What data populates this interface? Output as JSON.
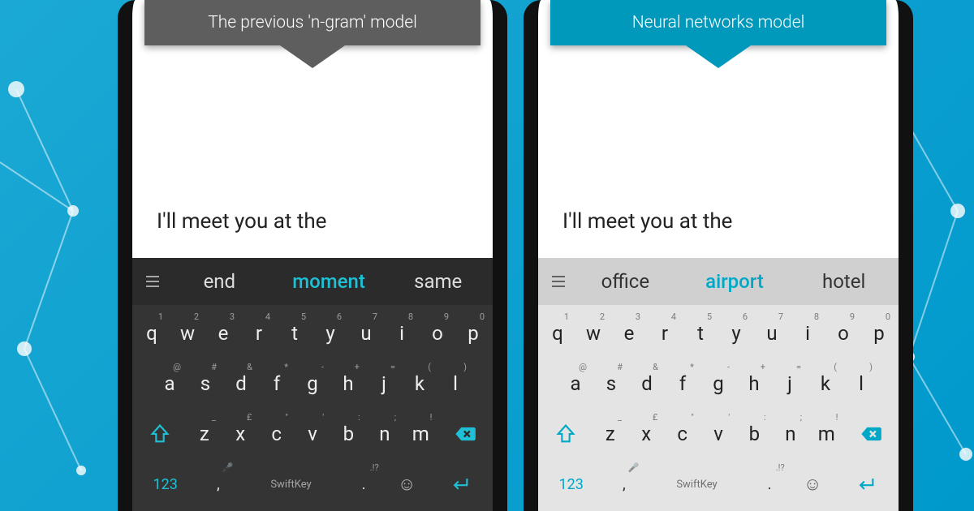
{
  "left": {
    "banner": "The previous 'n-gram' model",
    "typed_text": "I'll meet you at the",
    "suggestions": {
      "a": "end",
      "b": "moment",
      "c": "same"
    }
  },
  "right": {
    "banner": "Neural networks model",
    "typed_text": "I'll meet you at the",
    "suggestions": {
      "a": "office",
      "b": "airport",
      "c": "hotel"
    }
  },
  "keyboard": {
    "row1_letters": [
      "q",
      "w",
      "e",
      "r",
      "t",
      "y",
      "u",
      "i",
      "o",
      "p"
    ],
    "row1_nums": [
      "1",
      "2",
      "3",
      "4",
      "5",
      "6",
      "7",
      "8",
      "9",
      "0"
    ],
    "row2_letters": [
      "a",
      "s",
      "d",
      "f",
      "g",
      "h",
      "j",
      "k",
      "l"
    ],
    "row2_syms": [
      "@",
      "#",
      "&",
      "*",
      "-",
      "+",
      "=",
      "(",
      ")"
    ],
    "row3_letters": [
      "z",
      "x",
      "c",
      "v",
      "b",
      "n",
      "m"
    ],
    "row3_syms": [
      "_",
      "£",
      "\"",
      "'",
      ":",
      ";",
      "!"
    ],
    "numeric_key": "123",
    "comma": ",",
    "period": ".",
    "period_alt": ".!?",
    "brand": "SwiftKey",
    "mic_alt": "🎤"
  }
}
